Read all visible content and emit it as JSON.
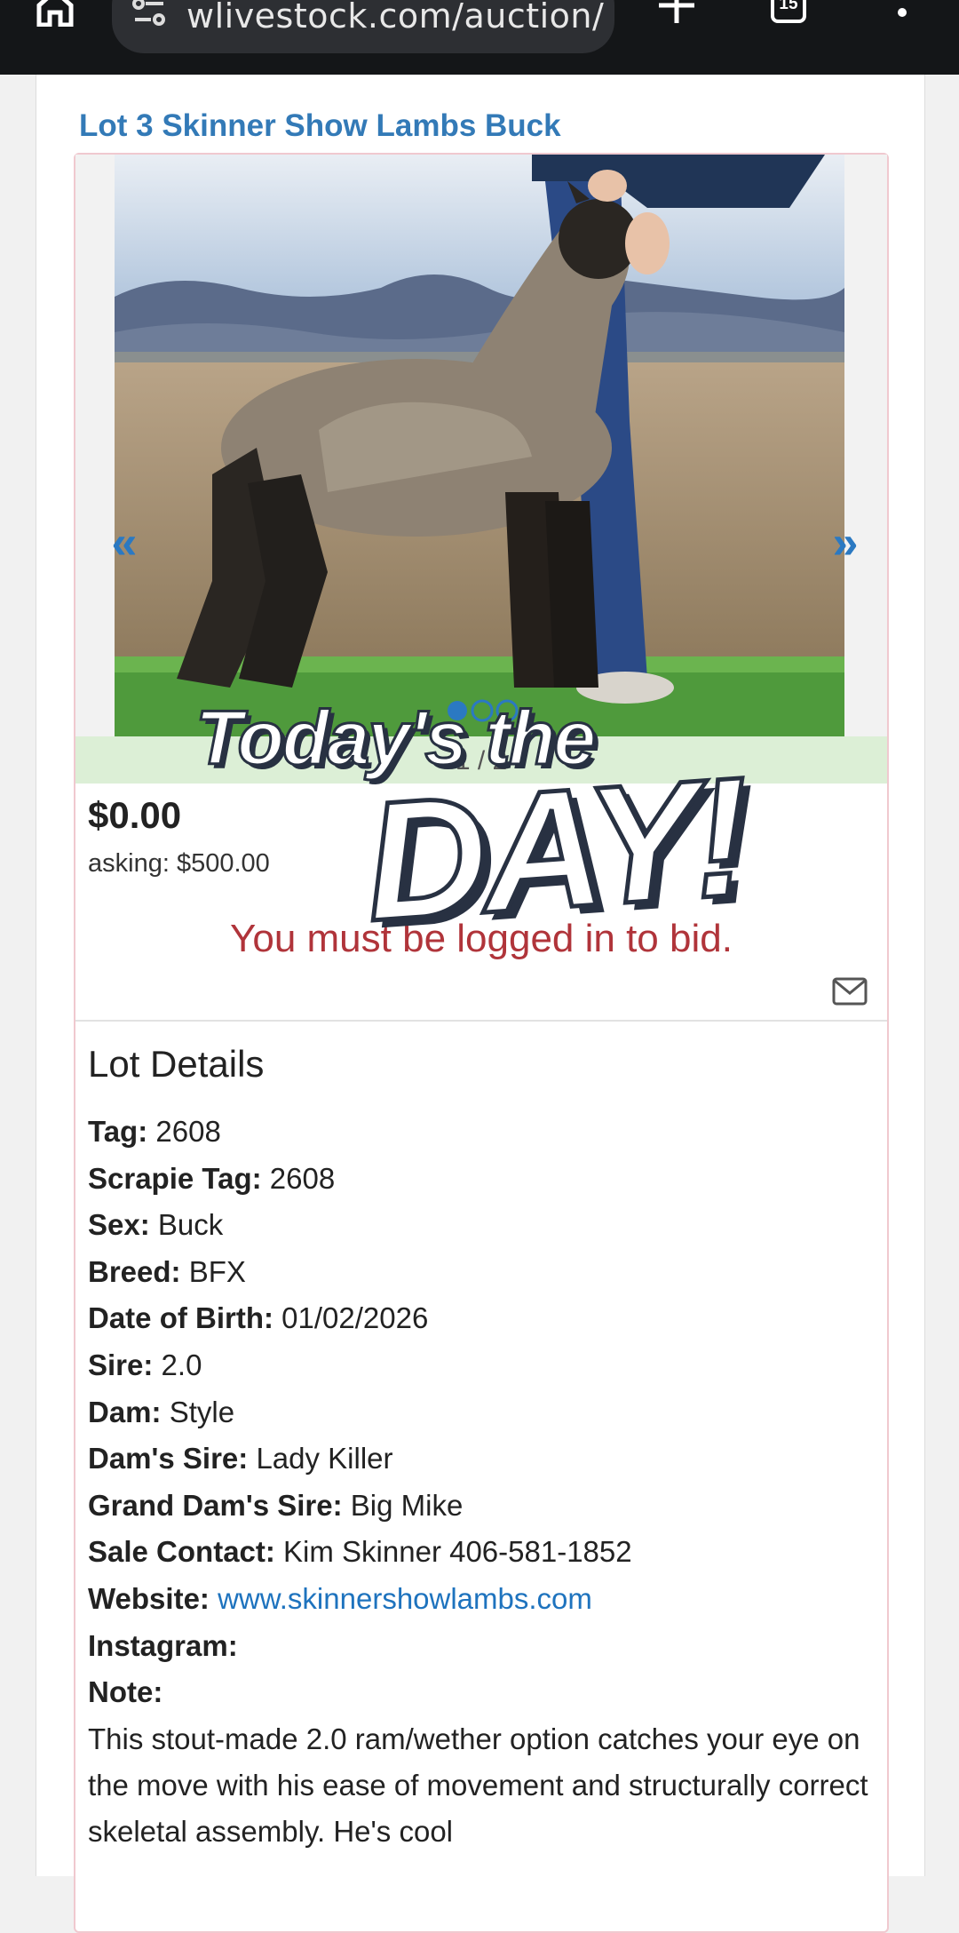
{
  "browser": {
    "url": "wlivestock.com/auction/",
    "tab_count": "15",
    "icons": [
      "home-icon",
      "site-settings-icon",
      "plus-icon",
      "tabs-icon",
      "more-menu-icon"
    ]
  },
  "lot": {
    "title": "Lot 3 Skinner Show Lambs Buck",
    "slide_counter": "1 / 2",
    "price": "$0.00",
    "asking": "asking: $500.00",
    "login_message": "You must be logged in to bid."
  },
  "details": {
    "heading": "Lot Details",
    "fields": [
      {
        "key": "Tag:",
        "value": "2608"
      },
      {
        "key": "Scrapie Tag:",
        "value": "2608"
      },
      {
        "key": "Sex:",
        "value": "Buck"
      },
      {
        "key": "Breed:",
        "value": "BFX"
      },
      {
        "key": "Date of Birth:",
        "value": "01/02/2026"
      },
      {
        "key": "Sire:",
        "value": "2.0"
      },
      {
        "key": "Dam:",
        "value": "Style"
      },
      {
        "key": "Dam's Sire:",
        "value": "Lady Killer"
      },
      {
        "key": "Grand Dam's Sire:",
        "value": "Big Mike"
      },
      {
        "key": "Sale Contact:",
        "value": "Kim Skinner 406-581-1852"
      },
      {
        "key": "Website:",
        "value": "www.skinnershowlambs.com"
      },
      {
        "key": "Instagram:",
        "value": ""
      },
      {
        "key": "Note:",
        "value": ""
      }
    ],
    "note": "This stout-made 2.0 ram/wether option catches your eye on the move with his ease of movement and structurally correct skeletal assembly. He's cool"
  },
  "overlay": {
    "line1": "Today's the",
    "line2": "DAY!"
  },
  "colors": {
    "link": "#337ab7",
    "login_message": "#b0343a",
    "card_border": "#f0c9cf"
  }
}
